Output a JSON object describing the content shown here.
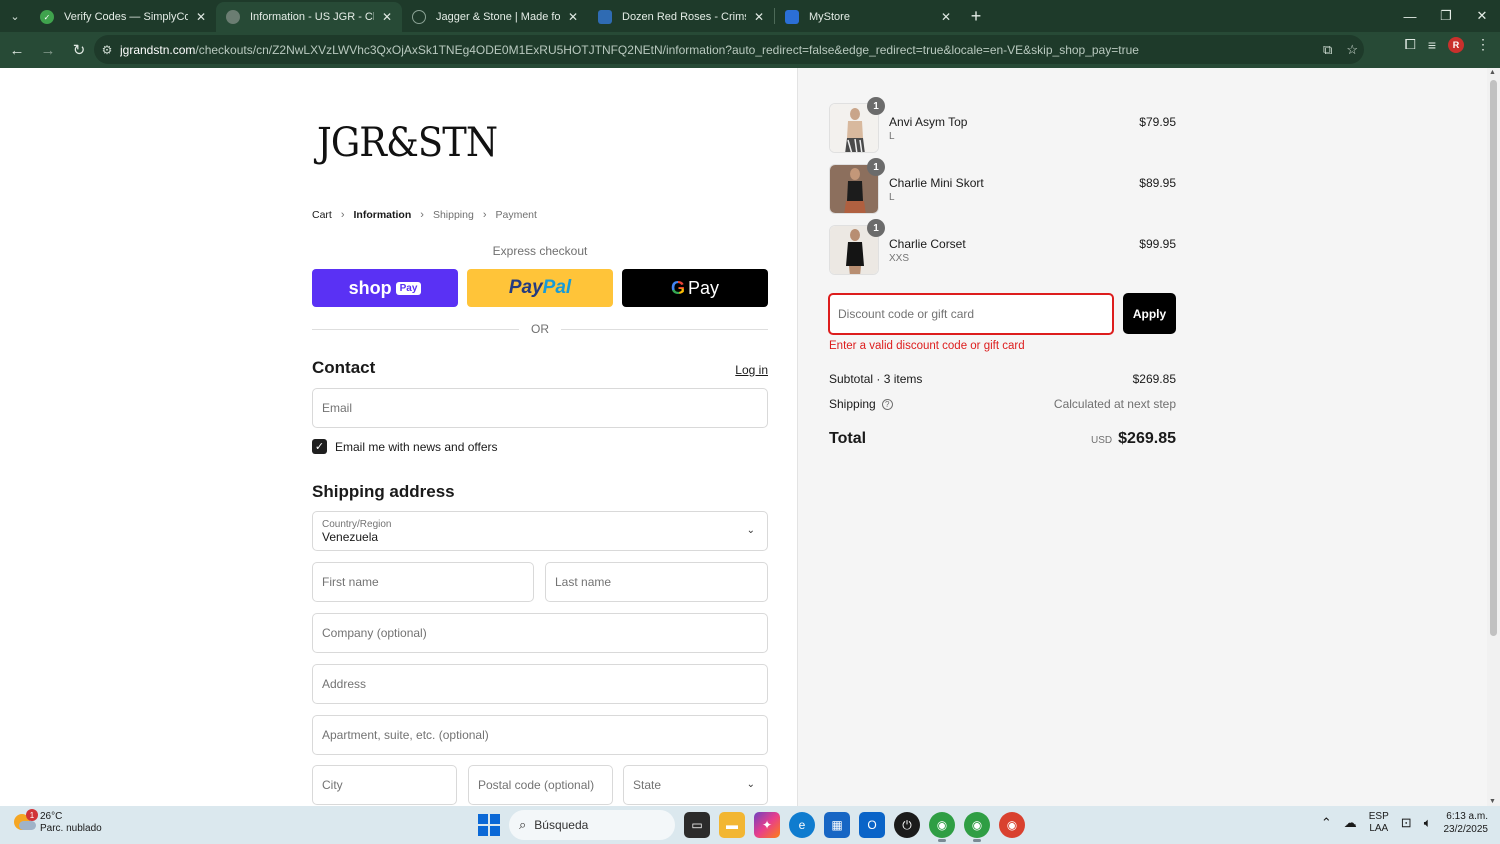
{
  "browser": {
    "tabs": [
      {
        "title": "Verify Codes — SimplyCodes",
        "favicon_color": "#3fa34d",
        "active": false
      },
      {
        "title": "Information - US JGR - Checkout",
        "favicon_color": "#6b7d72",
        "active": true
      },
      {
        "title": "Jagger & Stone | Made for Bad",
        "favicon_color": "#1e3a2a",
        "active": false
      },
      {
        "title": "Dozen Red Roses - Crimson Ro",
        "favicon_color": "#2f6bb3",
        "active": false
      },
      {
        "title": "MyStore",
        "favicon_color": "#2b6fd6",
        "active": false
      }
    ],
    "url_host": "jgrandstn.com",
    "url_path": "/checkouts/cn/Z2NwLXVzLWVhc3QxOjAxSk1TNEg4ODE0M1ExRU5HOTJTNFQ2NEtN/information?auto_redirect=false&edge_redirect=true&locale=en-VE&skip_shop_pay=true",
    "profile_initial": "R"
  },
  "checkout": {
    "logo": "JGR&STN",
    "breadcrumb": {
      "cart": "Cart",
      "information": "Information",
      "shipping": "Shipping",
      "payment": "Payment"
    },
    "express_title": "Express checkout",
    "shop_label": "shop",
    "shop_pay_badge": "Pay",
    "paypal_label_1": "Pay",
    "paypal_label_2": "Pal",
    "gpay_g": "G",
    "gpay_label": "Pay",
    "or_label": "OR",
    "contact_title": "Contact",
    "login_label": "Log in",
    "email_placeholder": "Email",
    "news_label": "Email me with news and offers",
    "news_checked": true,
    "shipping_title": "Shipping address",
    "country_label": "Country/Region",
    "country_value": "Venezuela",
    "first_name_placeholder": "First name",
    "last_name_placeholder": "Last name",
    "company_placeholder": "Company (optional)",
    "address_placeholder": "Address",
    "apartment_placeholder": "Apartment, suite, etc. (optional)",
    "city_placeholder": "City",
    "postal_placeholder": "Postal code (optional)",
    "state_label": "State"
  },
  "summary": {
    "items": [
      {
        "name": "Anvi Asym Top",
        "variant": "L",
        "price": "$79.95",
        "qty": "1"
      },
      {
        "name": "Charlie Mini Skort",
        "variant": "L",
        "price": "$89.95",
        "qty": "1"
      },
      {
        "name": "Charlie Corset",
        "variant": "XXS",
        "price": "$99.95",
        "qty": "1"
      }
    ],
    "discount_placeholder": "Discount code or gift card",
    "apply_label": "Apply",
    "error_text": "Enter a valid discount code or gift card",
    "subtotal_label": "Subtotal · 3 items",
    "subtotal_value": "$269.85",
    "shipping_label": "Shipping",
    "shipping_value": "Calculated at next step",
    "total_label": "Total",
    "total_currency": "USD",
    "total_value": "$269.85"
  },
  "taskbar": {
    "temperature": "26°C",
    "weather": "Parc. nublado",
    "weather_badge": "1",
    "search_label": "Búsqueda",
    "lang_1": "ESP",
    "lang_2": "LAA",
    "time": "6:13 a.m.",
    "date": "23/2/2025"
  }
}
